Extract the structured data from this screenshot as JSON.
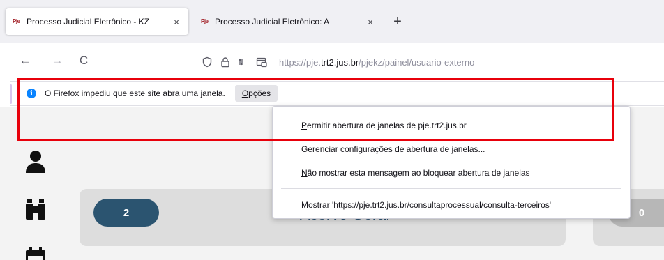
{
  "tabs": [
    {
      "favicon": "Pje",
      "title": "Processo Judicial Eletrônico - KZ",
      "close": "×"
    },
    {
      "favicon": "Pje",
      "title": "Processo Judicial Eletrônico: A",
      "close": "×"
    }
  ],
  "newtab": "+",
  "nav": {
    "back": "←",
    "forward": "→",
    "reload": "C",
    "url_prefix": "https://pje.",
    "url_domain": "trt2.jus.br",
    "url_path": "/pjekz/painel/usuario-externo"
  },
  "notification": {
    "message": "O Firefox impediu que este site abra uma janela.",
    "options_first": "O",
    "options_rest": "pções"
  },
  "menu": {
    "items": [
      {
        "accel": "P",
        "rest": "ermitir abertura de janelas de pje.trt2.jus.br"
      },
      {
        "accel": "G",
        "rest": "erenciar configurações de abertura de janelas..."
      },
      {
        "accel": "N",
        "rest": "ão mostrar esta mensagem ao bloquear abertura de janelas"
      },
      {
        "accel": "",
        "rest": "Mostrar 'https://pje.trt2.jus.br/consultaprocessual/consulta-terceiros'"
      }
    ]
  },
  "page": {
    "card_badge": "2",
    "card_title": "Acervo Geral",
    "card2_badge": "0"
  },
  "icons": {
    "side": [
      "user-icon",
      "binoculars-icon",
      "calendar-icon"
    ]
  },
  "colors": {
    "highlight_box": "#e8000b",
    "info": "#0a84ff",
    "badge": "#2b5470"
  }
}
